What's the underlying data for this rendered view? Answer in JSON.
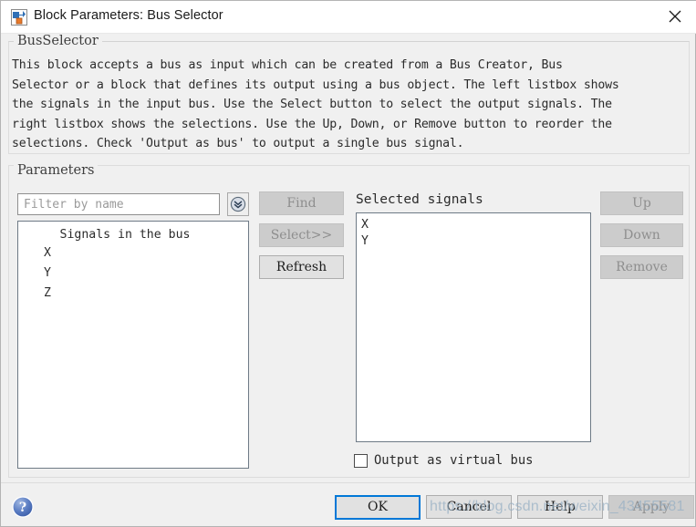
{
  "window": {
    "title": "Block Parameters: Bus Selector",
    "icon": "simulink-block-icon",
    "close_label": "close-icon"
  },
  "description": {
    "legend": "BusSelector",
    "text": "This block accepts a bus as input which can be created from a Bus Creator, Bus\nSelector or a block that defines its output using a bus object. The left listbox shows\nthe signals in the input bus. Use the Select button to select the output signals. The\nright listbox shows the selections. Use the Up, Down, or Remove button to reorder the\nselections. Check 'Output as bus' to output a single bus signal."
  },
  "parameters": {
    "legend": "Parameters",
    "filter": {
      "value": "",
      "placeholder": "Filter by name",
      "dropdown_icon": "chevron-double-down-icon"
    },
    "signals_listbox": {
      "header": "Signals in the bus",
      "items": [
        "X",
        "Y",
        "Z"
      ]
    },
    "middle_buttons": [
      {
        "label": "Find",
        "enabled": false
      },
      {
        "label": "Select>>",
        "enabled": false
      },
      {
        "label": "Refresh",
        "enabled": true
      }
    ],
    "selected": {
      "label": "Selected signals",
      "items": [
        "X",
        "Y"
      ]
    },
    "right_buttons": [
      {
        "label": "Up",
        "enabled": false
      },
      {
        "label": "Down",
        "enabled": false
      },
      {
        "label": "Remove",
        "enabled": false
      }
    ],
    "virtual_bus": {
      "label": "Output as virtual bus",
      "checked": false
    }
  },
  "footer": {
    "help_icon": "help-circle-icon",
    "buttons": [
      {
        "label": "OK",
        "enabled": true,
        "focused": true
      },
      {
        "label": "Cancel",
        "enabled": true,
        "focused": false
      },
      {
        "label": "Help",
        "enabled": true,
        "focused": false
      },
      {
        "label": "Apply",
        "enabled": false,
        "focused": false
      }
    ]
  },
  "watermark": {
    "text": "https://blog.csdn.net/weixin_43455581"
  },
  "colors": {
    "accent_focus": "#0078d7",
    "dialog_bg": "#f0f0f0",
    "button_bg": "#e1e1e1",
    "button_disabled_bg": "#cccccc",
    "listbox_bg": "#ffffff"
  }
}
